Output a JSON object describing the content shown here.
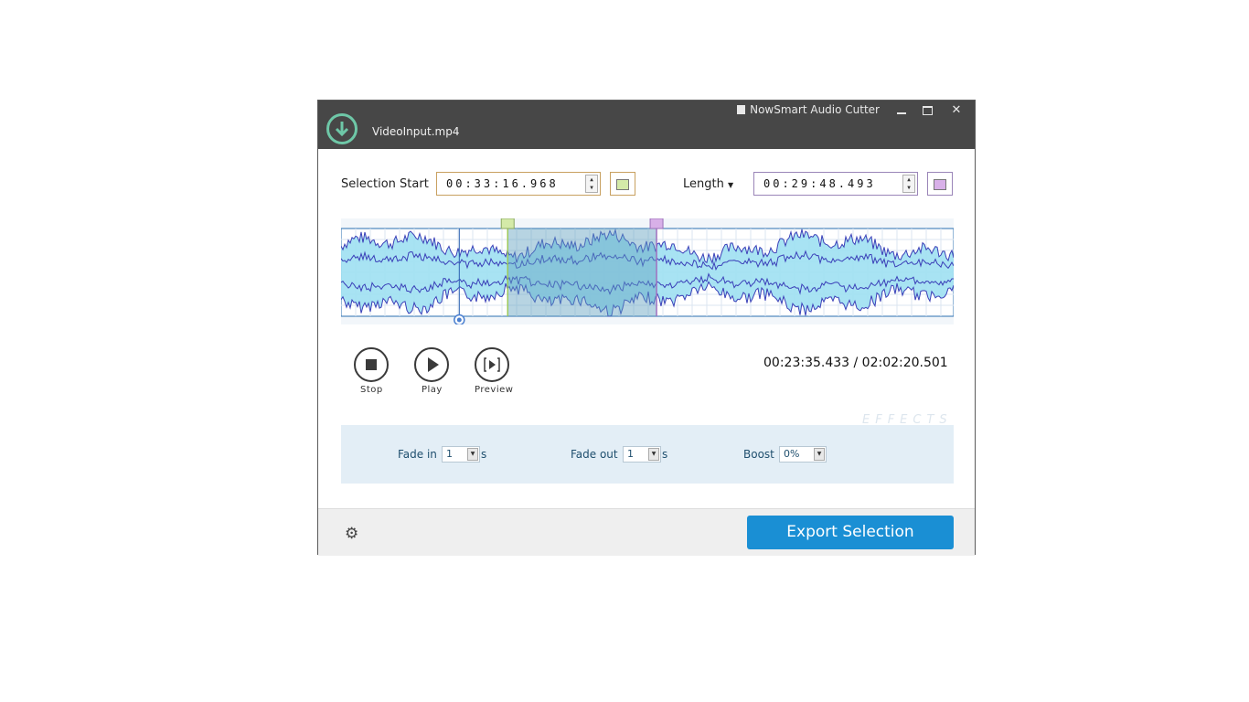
{
  "window": {
    "app_title": "NowSmart Audio Cutter",
    "file_name": "VideoInput.mp4",
    "minimize_icon": "minimize-icon",
    "maximize_icon": "maximize-icon",
    "close_icon": "close-icon",
    "close_glyph": "✕"
  },
  "selection": {
    "start_label": "Selection Start",
    "start_value": "00:33:16.968",
    "start_color": "#d4eaa8",
    "length_label": "Length",
    "length_value": "00:29:48.493",
    "length_color": "#d8b0e8"
  },
  "waveform": {
    "fill_color": "#9fe0f2",
    "line_color": "#3a3fb8",
    "selection_shade": "#5f9fbf",
    "playhead_fraction": 0.193,
    "selection_start_fraction": 0.272,
    "selection_end_fraction": 0.515
  },
  "controls": {
    "stop_label": "Stop",
    "play_label": "Play",
    "preview_label": "Preview",
    "time_readout": "00:23:35.433 / 02:02:20.501"
  },
  "effects": {
    "tag": "EFFECTS",
    "fade_in_label": "Fade in",
    "fade_in_value": "1",
    "fade_in_unit": "s",
    "fade_out_label": "Fade out",
    "fade_out_value": "1",
    "fade_out_unit": "s",
    "boost_label": "Boost",
    "boost_value": "0%"
  },
  "footer": {
    "settings_icon": "gear-icon",
    "export_label": "Export Selection"
  },
  "colors": {
    "titlebar": "#474747",
    "accent": "#1a8fd4",
    "download_icon": "#6ec7a7"
  }
}
